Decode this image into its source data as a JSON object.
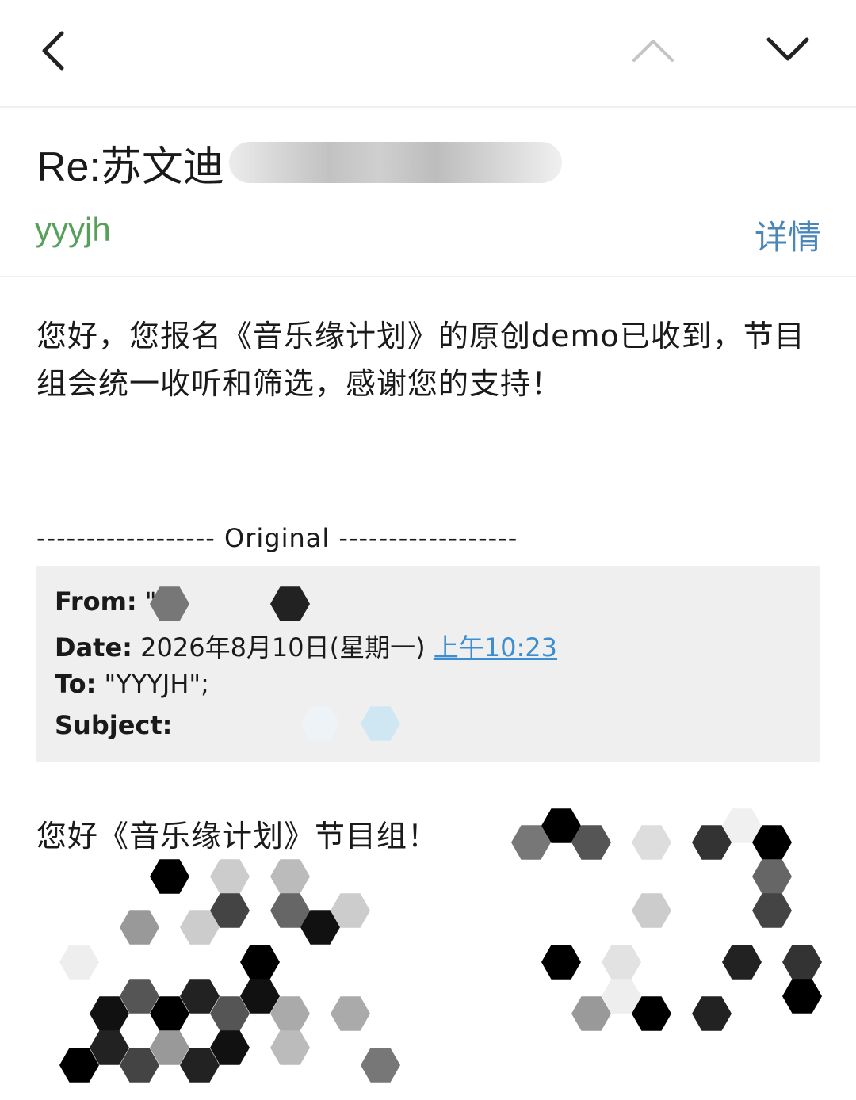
{
  "nav": {
    "back_icon": "chevron-left-icon",
    "prev_icon": "chevron-up-icon",
    "next_icon": "chevron-down-icon"
  },
  "email": {
    "subject_prefix": "Re:苏文迪",
    "sender": "yyyjh",
    "details_label": "详情",
    "body": "您好，您报名《音乐缘计划》的原创demo已收到，节目组会统一收听和筛选，感谢您的支持！",
    "original_separator": "------------------ Original ------------------",
    "quote": {
      "from_label": "From:",
      "from_value": "\"",
      "date_label": "Date:",
      "date_value": "2026年8月10日(星期一)",
      "date_time_link": "上午10:23",
      "to_label": "To:",
      "to_value": "\"YYYJH\";",
      "subject_label": "Subject:"
    },
    "greeting": "您好《音乐缘计划》节目组！"
  },
  "colors": {
    "sender": "#57a05c",
    "details": "#4a86b8",
    "link": "#3c8ed0",
    "quote_bg": "#efefef"
  }
}
